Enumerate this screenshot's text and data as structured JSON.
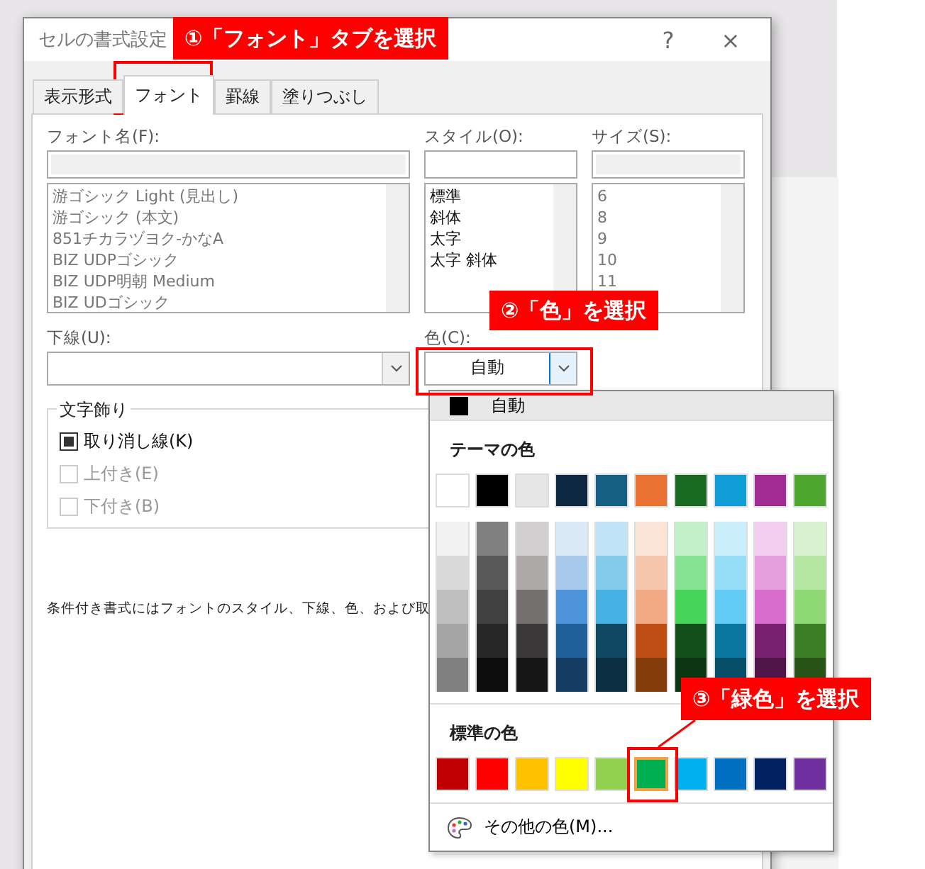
{
  "dialog": {
    "title": "セルの書式設定",
    "help": "?",
    "close": "×"
  },
  "tabs": [
    {
      "label": "表示形式",
      "selected": false
    },
    {
      "label": "フォント",
      "selected": true
    },
    {
      "label": "罫線",
      "selected": false
    },
    {
      "label": "塗りつぶし",
      "selected": false
    }
  ],
  "font_name": {
    "label": "フォント名(F):",
    "items": [
      "游ゴシック Light (見出し)",
      "游ゴシック (本文)",
      "851チカラヅヨク-かなA",
      "BIZ UDPゴシック",
      "BIZ UDP明朝 Medium",
      "BIZ UDゴシック"
    ]
  },
  "style": {
    "label": "スタイル(O):",
    "items": [
      "標準",
      "斜体",
      "太字",
      "太字 斜体"
    ]
  },
  "size": {
    "label": "サイズ(S):",
    "items": [
      "6",
      "8",
      "9",
      "10",
      "11"
    ]
  },
  "underline": {
    "label": "下線(U):"
  },
  "color": {
    "label": "色(C):",
    "value": "自動"
  },
  "effects": {
    "title": "文字飾り",
    "options": [
      {
        "label": "取り消し線(K)",
        "checked": true,
        "disabled": false
      },
      {
        "label": "上付き(E)",
        "checked": false,
        "disabled": true
      },
      {
        "label": "下付き(B)",
        "checked": false,
        "disabled": true
      }
    ]
  },
  "note": "条件付き書式にはフォントのスタイル、下線、色、および取",
  "palette": {
    "automatic": "自動",
    "theme_title": "テーマの色",
    "theme_colors": [
      {
        "color": "#ffffff"
      },
      {
        "color": "#000000"
      },
      {
        "color": "#e7e6e6"
      },
      {
        "color": "#0e2841"
      },
      {
        "color": "#156082"
      },
      {
        "color": "#e97132"
      },
      {
        "color": "#196b24"
      },
      {
        "color": "#0f9ed5"
      },
      {
        "color": "#a02b93"
      },
      {
        "color": "#4ea72e"
      }
    ],
    "shades": [
      {
        "color": "#f2f2f2"
      },
      {
        "color": "#808080"
      },
      {
        "color": "#d0cece"
      },
      {
        "color": "#dceaf7"
      },
      {
        "color": "#c0e4f5"
      },
      {
        "color": "#fbe3d6"
      },
      {
        "color": "#c2f1c8"
      },
      {
        "color": "#caedfb"
      },
      {
        "color": "#f2cfee"
      },
      {
        "color": "#daf2d0"
      },
      {
        "color": "#d9d9d9"
      },
      {
        "color": "#595959"
      },
      {
        "color": "#aeaaaa"
      },
      {
        "color": "#a6c9ec"
      },
      {
        "color": "#83cbeb"
      },
      {
        "color": "#f6c6ad"
      },
      {
        "color": "#84e291"
      },
      {
        "color": "#95dcf7"
      },
      {
        "color": "#e59edd"
      },
      {
        "color": "#b5e6a2"
      },
      {
        "color": "#bfbfbf"
      },
      {
        "color": "#404040"
      },
      {
        "color": "#757171"
      },
      {
        "color": "#4d93d9"
      },
      {
        "color": "#47b0e2"
      },
      {
        "color": "#f1a983"
      },
      {
        "color": "#47d45a"
      },
      {
        "color": "#61cbf3"
      },
      {
        "color": "#d86dcd"
      },
      {
        "color": "#8ed973"
      },
      {
        "color": "#a6a6a6"
      },
      {
        "color": "#262626"
      },
      {
        "color": "#3a3838"
      },
      {
        "color": "#215f9a"
      },
      {
        "color": "#104862"
      },
      {
        "color": "#c04f15"
      },
      {
        "color": "#124f1a"
      },
      {
        "color": "#0b769f"
      },
      {
        "color": "#782170"
      },
      {
        "color": "#3b7d23"
      },
      {
        "color": "#808080"
      },
      {
        "color": "#0d0d0d"
      },
      {
        "color": "#161616"
      },
      {
        "color": "#153d64"
      },
      {
        "color": "#0b3041"
      },
      {
        "color": "#843c0c"
      },
      {
        "color": "#0c3511"
      },
      {
        "color": "#074f69"
      },
      {
        "color": "#501549"
      },
      {
        "color": "#275317"
      }
    ],
    "standard_title": "標準の色",
    "standard_colors": [
      {
        "color": "#c00000",
        "selected": false
      },
      {
        "color": "#ff0000",
        "selected": false
      },
      {
        "color": "#ffc000",
        "selected": false
      },
      {
        "color": "#ffff00",
        "selected": false
      },
      {
        "color": "#92d050",
        "selected": false
      },
      {
        "color": "#00b050",
        "selected": true
      },
      {
        "color": "#00b0f0",
        "selected": false
      },
      {
        "color": "#0070c0",
        "selected": false
      },
      {
        "color": "#002060",
        "selected": false
      },
      {
        "color": "#7030a0",
        "selected": false
      }
    ],
    "more": "その他の色(M)..."
  },
  "annotations": [
    "①「フォント」タブを選択",
    "②「色」を選択",
    "③「緑色」を選択"
  ]
}
